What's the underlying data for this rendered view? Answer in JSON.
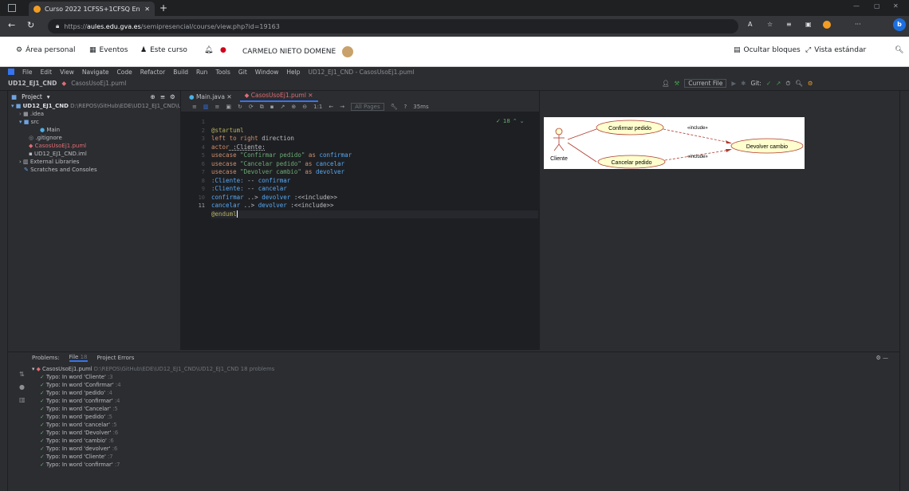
{
  "browser": {
    "tab_title": "Curso 2022 1CFSS+1CFSQ Ento",
    "url_prefix": "https://",
    "url_domain": "aules.edu.gva.es",
    "url_path": "/semipresencial/course/view.php?id=19163"
  },
  "moodle": {
    "area_personal": "Área personal",
    "eventos": "Eventos",
    "este_curso": "Este curso",
    "user_name": "CARMELO NIETO DOMENE",
    "ocultar_bloques": "Ocultar bloques",
    "vista_estandar": "Vista estándar"
  },
  "ide": {
    "menu": [
      "File",
      "Edit",
      "View",
      "Navigate",
      "Code",
      "Refactor",
      "Build",
      "Run",
      "Tools",
      "Git",
      "Window",
      "Help"
    ],
    "window_title": "UD12_EJ1_CND - CasosUsoEj1.puml",
    "breadcrumb_project": "UD12_EJ1_CND",
    "breadcrumb_file": "CasosUsoEj1.puml",
    "run_config": "Current File",
    "git_label": "Git:",
    "project_tab": "Project",
    "tree": [
      {
        "label": "UD12_EJ1_CND",
        "extra": "D:\\REPOS\\GitHub\\EDE\\UD12_EJ1_CND\\U",
        "indent": 0
      },
      {
        "label": ".idea",
        "extra": "",
        "indent": 1
      },
      {
        "label": "src",
        "extra": "",
        "indent": 1
      },
      {
        "label": "Main",
        "extra": "",
        "indent": 3
      },
      {
        "label": ".gitignore",
        "extra": "",
        "indent": 2
      },
      {
        "label": "CasosUsoEj1.puml",
        "extra": "",
        "indent": 2
      },
      {
        "label": "UD12_EJ1_CND.iml",
        "extra": "",
        "indent": 2
      },
      {
        "label": "External Libraries",
        "extra": "",
        "indent": 1
      },
      {
        "label": "Scratches and Consoles",
        "extra": "",
        "indent": 1
      }
    ],
    "editor_tabs": [
      "Main.java",
      "CasosUsoEj1.puml"
    ],
    "pages_select": "All Pages",
    "timing": "35ms",
    "problems_count": "18",
    "line_numbers": [
      "1",
      "2",
      "3",
      "4",
      "5",
      "6",
      "7",
      "8",
      "9",
      "10",
      "11"
    ]
  },
  "code": {
    "l1": "@startuml",
    "l2_kw": "left to right",
    "l2_rest": " direction",
    "l3_kw": "actor",
    "l3_rest": " :Cliente:",
    "l4_kw": "usecase",
    "l4_str": " \"Confirmar pedido\"",
    "l4_as": " as ",
    "l4_id": "confirmar",
    "l5_kw": "usecase",
    "l5_str": " \"Cancelar pedido\"",
    "l5_as": " as ",
    "l5_id": "cancelar",
    "l6_kw": "usecase",
    "l6_str": " \"Devolver cambio\"",
    "l6_as": " as ",
    "l6_id": "devolver",
    "l7_a": ":Cliente:",
    "l7_op": " -- ",
    "l7_b": "confirmar",
    "l8_a": ":Cliente:",
    "l8_op": " -- ",
    "l8_b": "cancelar",
    "l9_a": "confirmar",
    "l9_op": " ..> ",
    "l9_b": "devolver",
    "l9_c": " :<<include>>",
    "l10_a": "cancelar",
    "l10_op": " ..> ",
    "l10_b": "devolver",
    "l10_c": " :<<include>>",
    "l11": "@enduml"
  },
  "diagram": {
    "actor": "Cliente",
    "uc1": "Confirmar pedido",
    "uc2": "Cancelar pedido",
    "uc3": "Devolver cambio",
    "include1": "«include»",
    "include2": "«include»"
  },
  "problems": {
    "tab_problems": "Problems:",
    "tab_file": "File",
    "tab_file_count": "18",
    "tab_project": "Project Errors",
    "file_line": "CasosUsoEj1.puml",
    "file_path": "D:\\REPOS\\GitHub\\EDE\\UD12_EJ1_CND\\UD12_EJ1_CND",
    "file_count": "18 problems",
    "items": [
      {
        "word": "Typo: In word 'Cliente'",
        "line": ":3"
      },
      {
        "word": "Typo: In word 'Confirmar'",
        "line": ":4"
      },
      {
        "word": "Typo: In word 'pedido'",
        "line": ":4"
      },
      {
        "word": "Typo: In word 'confirmar'",
        "line": ":4"
      },
      {
        "word": "Typo: In word 'Cancelar'",
        "line": ":5"
      },
      {
        "word": "Typo: In word 'pedido'",
        "line": ":5"
      },
      {
        "word": "Typo: In word 'cancelar'",
        "line": ":5"
      },
      {
        "word": "Typo: In word 'Devolver'",
        "line": ":6"
      },
      {
        "word": "Typo: In word 'cambio'",
        "line": ":6"
      },
      {
        "word": "Typo: In word 'devolver'",
        "line": ":6"
      },
      {
        "word": "Typo: In word 'Cliente'",
        "line": ":7"
      },
      {
        "word": "Typo: In word 'confirmar'",
        "line": ":7"
      }
    ]
  },
  "colors": {
    "accent": "#3574f0",
    "moodle_orange": "#f29d22"
  }
}
